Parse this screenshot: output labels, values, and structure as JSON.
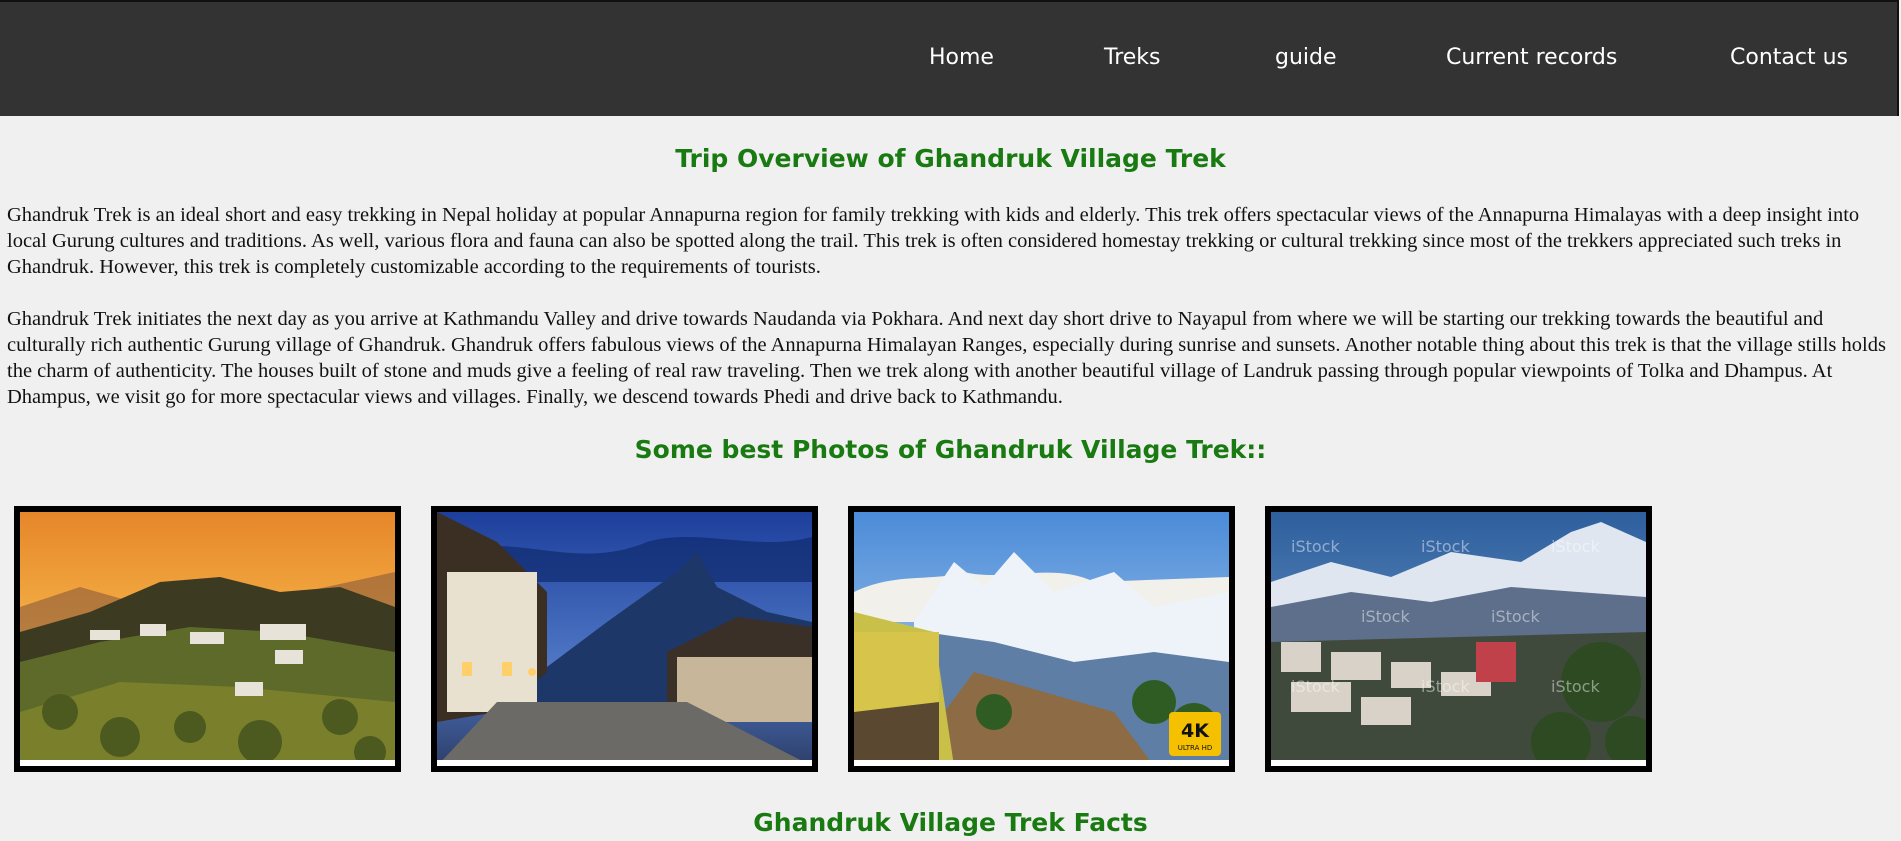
{
  "nav": {
    "items": [
      {
        "label": "Home"
      },
      {
        "label": "Treks"
      },
      {
        "label": "guide"
      },
      {
        "label": "Current records"
      },
      {
        "label": "Contact us"
      }
    ]
  },
  "overview": {
    "title": "Trip Overview of Ghandruk Village Trek",
    "paragraph1": "Ghandruk Trek is an ideal short and easy trekking in Nepal holiday at popular Annapurna region for family trekking with kids and elderly. This trek offers spectacular views of the Annapurna Himalayas with a deep insight into local Gurung cultures and traditions. As well, various flora and fauna can also be spotted along the trail. This trek is often considered homestay trekking or cultural trekking since most of the trekkers appreciated such treks in Ghandruk. However, this trek is completely customizable according to the requirements of tourists.",
    "paragraph2": "Ghandruk Trek initiates the next day as you arrive at Kathmandu Valley and drive towards Naudanda via Pokhara. And next day short drive to Nayapul from where we will be starting our trekking towards the beautiful and culturally rich authentic Gurung village of Ghandruk. Ghandruk offers fabulous views of the Annapurna Himalayan Ranges, especially during sunrise and sunsets. Another notable thing about this trek is that the village stills holds the charm of authenticity. The houses built of stone and muds give a feeling of real raw traveling. Then we trek along with another beautiful village of Landruk passing through popular viewpoints of Tolka and Dhampus. At Dhampus, we visit go for more spectacular views and villages. Finally, we descend towards Phedi and drive back to Kathmandu."
  },
  "photos": {
    "title": "Some best Photos of Ghandruk Village Trek::",
    "items": [
      {
        "subject": "village-sunset-photo"
      },
      {
        "subject": "stone-path-night-photo"
      },
      {
        "subject": "annapurna-view-photo",
        "badge_main": "4K",
        "badge_sub": "ULTRA HD"
      },
      {
        "subject": "village-mountain-stock-photo",
        "watermark": "iStock"
      }
    ]
  },
  "facts": {
    "title": "Ghandruk Village Trek Facts"
  },
  "colors": {
    "navbar_bg": "#333333",
    "page_bg": "#f0f0f0",
    "heading_green": "#1a7a12",
    "nav_text": "#ffffff"
  }
}
